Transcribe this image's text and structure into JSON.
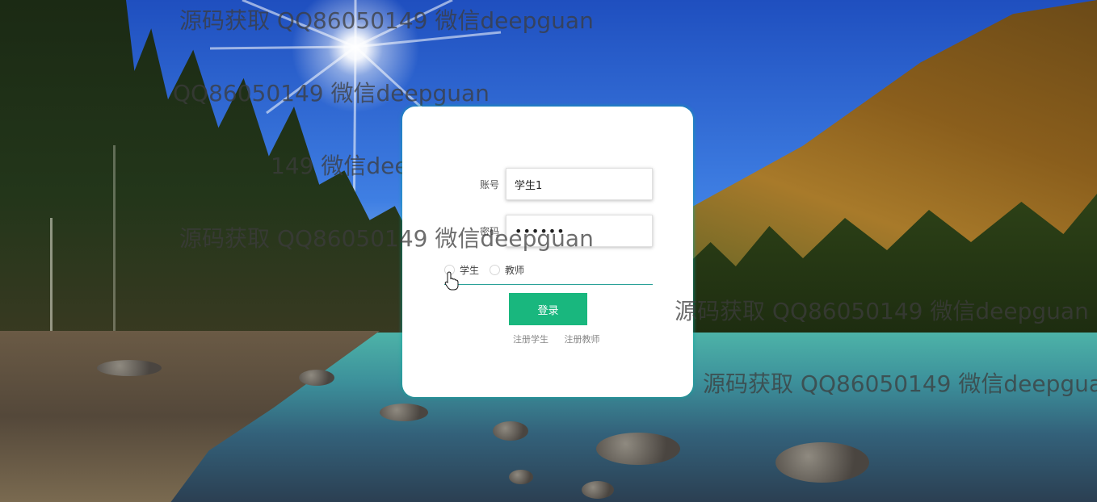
{
  "login": {
    "account_label": "账号",
    "account_value": "学生1",
    "password_label": "密码",
    "password_value": "••••••",
    "role_options": [
      "学生",
      "教师"
    ],
    "login_button": "登录",
    "links": [
      "注册学生",
      "注册教师"
    ]
  },
  "watermark": {
    "lines": [
      "源码获取 QQ86050149 微信deepguan",
      "QQ86050149 微信deepguan",
      "149 微信deepguan",
      "源码获取 QQ86050149 微信deepguan",
      "源码获取 QQ86050149 微信deepguan",
      "源码获取 QQ86050149 微信deepguan"
    ]
  },
  "colors": {
    "accent": "#19b77e",
    "card_border": "#2aa198"
  },
  "icons": [
    "hand-pointer-icon"
  ]
}
